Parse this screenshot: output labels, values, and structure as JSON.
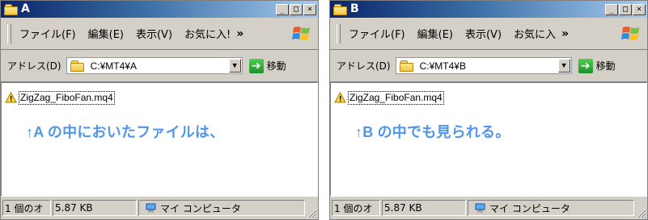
{
  "windows": [
    {
      "id": "A",
      "title": "A",
      "menus": {
        "file": "ファイル(F)",
        "edit": "編集(E)",
        "view": "表示(V)",
        "favorites": "お気に入!",
        "overflow": "»"
      },
      "address": {
        "label": "アドレス(D)",
        "path": "C:¥MT4¥A",
        "go_label": "移動"
      },
      "file": {
        "name": "ZigZag_FiboFan.mq4"
      },
      "caption": "↑A の中においたファイルは、",
      "status": {
        "count": "1 個のオ",
        "size": "5.87 KB",
        "location": "マイ コンピュータ"
      }
    },
    {
      "id": "B",
      "title": "B",
      "menus": {
        "file": "ファイル(F)",
        "edit": "編集(E)",
        "view": "表示(V)",
        "favorites": "お気に入",
        "overflow": "»"
      },
      "address": {
        "label": "アドレス(D)",
        "path": "C:¥MT4¥B",
        "go_label": "移動"
      },
      "file": {
        "name": "ZigZag_FiboFan.mq4"
      },
      "caption": "↑B の中でも見られる。",
      "status": {
        "count": "1 個のオ",
        "size": "5.87 KB",
        "location": "マイ コンピュータ"
      }
    }
  ],
  "colors": {
    "caption": "#4f95e8",
    "titlebar_start": "#0a246a",
    "titlebar_end": "#a6caf0",
    "window_face": "#d4d0c8"
  },
  "icons": {
    "title": "folder-icon",
    "address": "folder-icon",
    "go": "go-arrow-icon",
    "file": "warning-file-icon",
    "status": "my-computer-icon",
    "brand": "windows-logo-icon"
  }
}
